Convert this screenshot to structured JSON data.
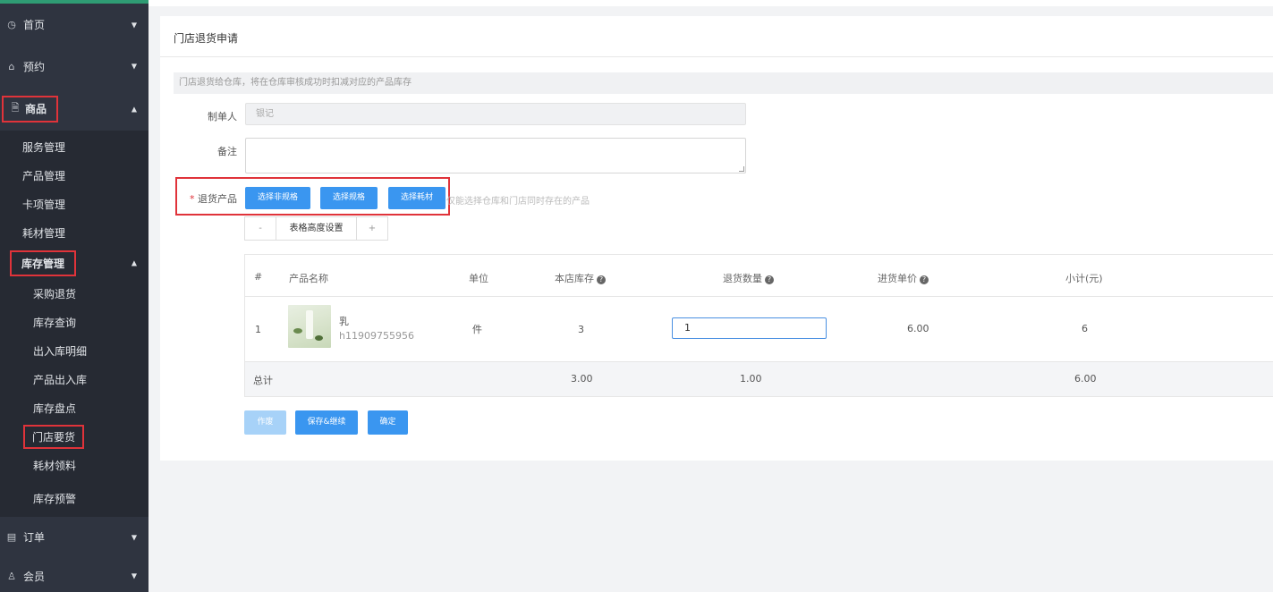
{
  "sidebar": {
    "home": "首页",
    "booking": "预约",
    "goods": "商品",
    "goods_items": {
      "service": "服务管理",
      "product": "产品管理",
      "card": "卡项管理",
      "material": "耗材管理",
      "inventory": "库存管理"
    },
    "inventory_items": {
      "purchase_return": "采购退货",
      "stock_query": "库存查询",
      "in_out_detail": "出入库明细",
      "product_in_out": "产品出入库",
      "stocktake": "库存盘点",
      "store_request": "门店要货",
      "material_pick": "耗材领料",
      "stock_alert": "库存预警"
    },
    "orders": "订单",
    "members": "会员",
    "colors": {
      "bg": "#2f3440",
      "sub_bg": "#262a33",
      "top_accent": "#2f9c74",
      "highlight_box": "#e0333a"
    }
  },
  "page": {
    "title": "门店退货申请",
    "notice": "门店退货给仓库，将在仓库审核成功时扣减对应的产品库存",
    "creator_label": "制单人",
    "creator_value": "银记",
    "remark_label": "备注",
    "return_product_label": "退货产品",
    "required_mark": "*",
    "btn_non_spec": "选择非规格",
    "btn_spec": "选择规格",
    "btn_material": "选择耗材",
    "hint": "仅能选择仓库和门店同时存在的产品",
    "table_height": {
      "minus": "-",
      "label": "表格高度设置",
      "plus": "+"
    }
  },
  "table": {
    "headers": {
      "no": "#",
      "name": "产品名称",
      "unit": "单位",
      "stock": "本店库存",
      "return_qty": "退货数量",
      "price": "进货单价",
      "subtotal": "小计(元)"
    },
    "tip_icon": "?",
    "row": {
      "no": "1",
      "name": "乳",
      "code": "h11909755956",
      "unit": "件",
      "stock": "3",
      "return_qty": "1",
      "price": "6.00",
      "subtotal": "6"
    },
    "total": {
      "label": "总计",
      "stock": "3.00",
      "return_qty": "1.00",
      "subtotal": "6.00"
    }
  },
  "actions": {
    "void": "作废",
    "save_continue": "保存&继续",
    "confirm": "确定"
  },
  "colors": {
    "primary": "#3a96f0",
    "primary_light": "#a7d2f8"
  }
}
